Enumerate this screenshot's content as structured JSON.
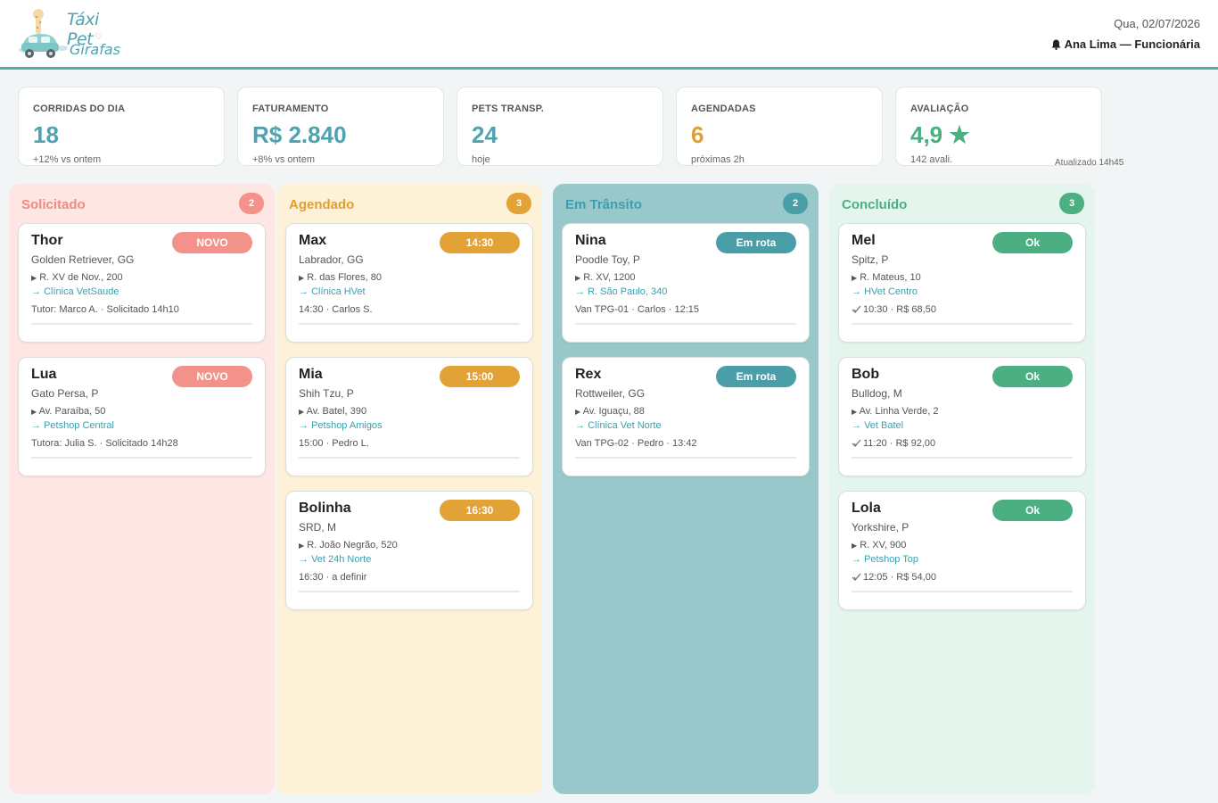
{
  "header": {
    "logo_top": "Táxi Pet",
    "logo_bottom": "Girafas",
    "date": "Qua, 02/07/2026",
    "user": "Ana Lima — Funcionária",
    "user_icon": "bell-icon"
  },
  "stats": [
    {
      "label": "CORRIDAS DO DIA",
      "value": "18",
      "sub": "+12% vs ontem",
      "color": "#4fa3b1"
    },
    {
      "label": "FATURAMENTO",
      "value": "R$ 2.840",
      "sub": "+8% vs ontem",
      "color": "#4fa3b1"
    },
    {
      "label": "PETS TRANSP.",
      "value": "24",
      "sub": "hoje",
      "color": "#4fa3b1"
    },
    {
      "label": "AGENDADAS",
      "value": "6",
      "sub": "próximas 2h",
      "color": "#e0a030"
    },
    {
      "label": "AVALIAÇÃO",
      "value": "4,9 ★",
      "sub": "142 avali.",
      "color": "#4caf82"
    }
  ],
  "updated": "Atualizado 14h45",
  "columns": [
    {
      "title": "Solicitado",
      "count": "2",
      "bg": "#fde6e4",
      "title_color": "#f08a82",
      "accent": "#f2928a",
      "cards": [
        {
          "name": "Thor",
          "breed": "Golden Retriever, GG",
          "from": "R. XV de Nov., 200",
          "to": "Clínica VetSaude",
          "info": "Tutor: Marco A. · Solicitado 14h10",
          "badge": "NOVO"
        },
        {
          "name": "Lua",
          "breed": "Gato Persa, P",
          "from": "Av. Paraíba, 50",
          "to": "Petshop Central",
          "info": "Tutora: Julia S. · Solicitado 14h28",
          "badge": "NOVO"
        }
      ]
    },
    {
      "title": "Agendado",
      "count": "3",
      "bg": "#fdf1d8",
      "title_color": "#e0a030",
      "accent": "#e3a235",
      "cards": [
        {
          "name": "Max",
          "breed": "Labrador, GG",
          "from": "R. das Flores, 80",
          "to": "Clínica HVet",
          "info": "14:30 · Carlos S.",
          "badge": "14:30"
        },
        {
          "name": "Mia",
          "breed": "Shih Tzu, P",
          "from": "Av. Batel, 390",
          "to": "Petshop Amigos",
          "info": "15:00 · Pedro L.",
          "badge": "15:00"
        },
        {
          "name": "Bolinha",
          "breed": "SRD, M",
          "from": "R. João Negrão, 520",
          "to": "Vet 24h Norte",
          "info": "16:30 · a definir",
          "badge": "16:30"
        }
      ]
    },
    {
      "title": "Em Trânsito",
      "count": "2",
      "bg": "#98c8c9",
      "title_color": "#3a9fb0",
      "accent": "#4a9ea8",
      "cards": [
        {
          "name": "Nina",
          "breed": "Poodle Toy, P",
          "from": "R. XV, 1200",
          "to": "R. São Paulo, 340",
          "info": "Van TPG-01 · Carlos · 12:15",
          "badge": "Em rota"
        },
        {
          "name": "Rex",
          "breed": "Rottweiler, GG",
          "from": "Av. Iguaçu, 88",
          "to": "Clínica Vet Norte",
          "info": "Van TPG-02 · Pedro · 13:42",
          "badge": "Em rota"
        }
      ]
    },
    {
      "title": "Concluído",
      "count": "3",
      "bg": "#e3f5ec",
      "title_color": "#4caf82",
      "accent": "#4caf82",
      "cards": [
        {
          "name": "Mel",
          "breed": "Spitz, P",
          "from": "R. Mateus, 10",
          "to": "HVet Centro",
          "info": "10:30 · R$ 68,50",
          "badge": "Ok"
        },
        {
          "name": "Bob",
          "breed": "Bulldog, M",
          "from": "Av. Linha Verde, 2",
          "to": "Vet Batel",
          "info": "11:20 · R$ 92,00",
          "badge": "Ok"
        },
        {
          "name": "Lola",
          "breed": "Yorkshire, P",
          "from": "R. XV, 900",
          "to": "Petshop Top",
          "info": "12:05 · R$ 54,00",
          "badge": "Ok"
        }
      ]
    }
  ],
  "icons": {
    "from": "triangle-right-icon",
    "to": "arrow-right-icon",
    "done": "check-icon"
  }
}
